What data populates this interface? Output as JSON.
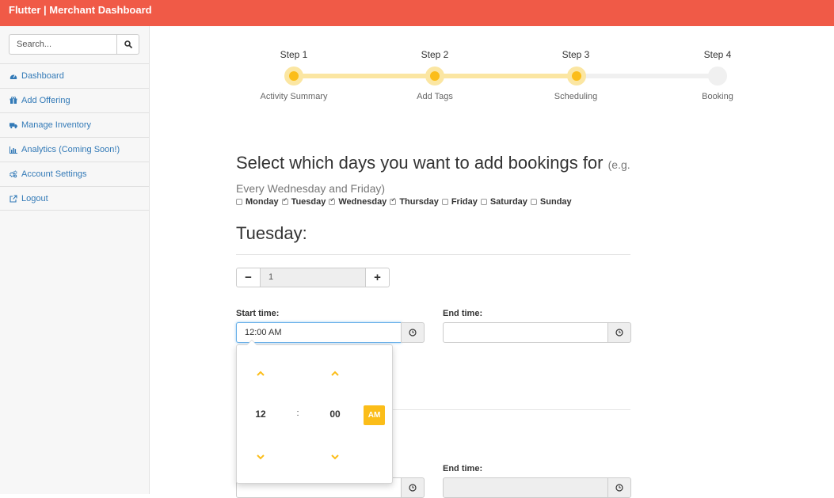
{
  "app": {
    "title": "Flutter | Merchant Dashboard"
  },
  "sidebar": {
    "search": {
      "placeholder": "Search..."
    },
    "items": [
      {
        "label": "Dashboard",
        "icon": "dashboard-icon"
      },
      {
        "label": "Add Offering",
        "icon": "gift-icon"
      },
      {
        "label": "Manage Inventory",
        "icon": "truck-icon"
      },
      {
        "label": "Analytics (Coming Soon!)",
        "icon": "bar-chart-icon"
      },
      {
        "label": "Account Settings",
        "icon": "gears-icon"
      },
      {
        "label": "Logout",
        "icon": "external-link-icon"
      }
    ]
  },
  "stepper": {
    "steps": [
      {
        "title": "Step 1",
        "label": "Activity Summary",
        "status": "complete"
      },
      {
        "title": "Step 2",
        "label": "Add Tags",
        "status": "complete"
      },
      {
        "title": "Step 3",
        "label": "Scheduling",
        "status": "current"
      },
      {
        "title": "Step 4",
        "label": "Booking",
        "status": "incomplete"
      }
    ]
  },
  "main": {
    "heading": "Select which days you want to add bookings for",
    "heading_hint": "(e.g. Every Wednesday and Friday)",
    "days": [
      {
        "label": "Monday",
        "checked": false
      },
      {
        "label": "Tuesday",
        "checked": true
      },
      {
        "label": "Wednesday",
        "checked": true
      },
      {
        "label": "Thursday",
        "checked": true
      },
      {
        "label": "Friday",
        "checked": false
      },
      {
        "label": "Saturday",
        "checked": false
      },
      {
        "label": "Sunday",
        "checked": false
      }
    ],
    "day_title": "Tuesday:",
    "quantity": {
      "minus": "−",
      "value": "1",
      "plus": "+"
    },
    "start_time_label": "Start time:",
    "start_time_value": "12:00 AM",
    "end_time_label": "End time:",
    "end_time_value": "",
    "end_time_label_2": "End time:"
  },
  "time_picker": {
    "hour": "12",
    "separator": ":",
    "minute": "00",
    "period": "AM"
  },
  "colors": {
    "header": "#f05a47",
    "accent": "#fbbd19",
    "accent_light": "#fbe6a2",
    "link": "#337ab7"
  }
}
